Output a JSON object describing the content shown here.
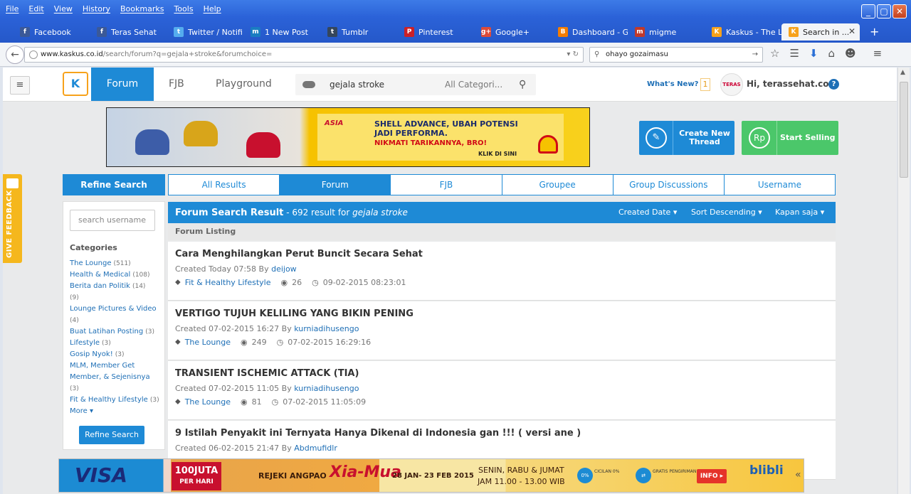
{
  "browser": {
    "menu": [
      "File",
      "Edit",
      "View",
      "History",
      "Bookmarks",
      "Tools",
      "Help"
    ],
    "tabs": [
      {
        "label": "Facebook",
        "icon": "facebook-icon",
        "color": "#3b5998",
        "glyph": "f"
      },
      {
        "label": "Teras Sehat",
        "icon": "facebook-icon",
        "color": "#3b5998",
        "glyph": "f"
      },
      {
        "label": "Twitter / Notifi...",
        "icon": "twitter-icon",
        "color": "#55acee",
        "glyph": "t"
      },
      {
        "label": "1 New Post",
        "icon": "multiply-icon",
        "color": "#1a7dc1",
        "glyph": "m"
      },
      {
        "label": "Tumblr",
        "icon": "tumblr-icon",
        "color": "#35465c",
        "glyph": "t"
      },
      {
        "label": "Pinterest",
        "icon": "pinterest-icon",
        "color": "#cb2027",
        "glyph": "P"
      },
      {
        "label": "Google+",
        "icon": "googleplus-icon",
        "color": "#dd4b39",
        "glyph": "g+"
      },
      {
        "label": "Dashboard - G...",
        "icon": "blogger-icon",
        "color": "#f57d00",
        "glyph": "B"
      },
      {
        "label": "migme",
        "icon": "migme-icon",
        "color": "#c0392b",
        "glyph": "m"
      },
      {
        "label": "Kaskus - The L...",
        "icon": "kaskus-icon",
        "color": "#f7a21b",
        "glyph": "K"
      },
      {
        "label": "Search in ...",
        "icon": "kaskus-icon",
        "color": "#f7a21b",
        "glyph": "K",
        "active": true
      }
    ],
    "new_tab": "+",
    "url_host": "www.kaskus.co.id",
    "url_path": "/search/forum?q=gejala+stroke&forumchoice=",
    "search_value": "ohayo gozaimasu",
    "win_min": "_",
    "win_max": "▢",
    "win_close": "✕"
  },
  "header": {
    "logo_text": "K",
    "tab_forum": "Forum",
    "link_fjb": "FJB",
    "link_playground": "Playground",
    "search_query": "gejala stroke",
    "search_category": "All Categori...",
    "whats_new": "What's New?",
    "notif_count": "1",
    "avatar_text": "TERAS",
    "greeting": "Hi, terassehat.com",
    "help": "?"
  },
  "banner": {
    "asia": "ASIA",
    "line1": "SHELL ADVANCE, UBAH POTENSI",
    "line1b": "JADI PERFORMA.",
    "line2": "NIKMATI TARIKANNYA, BRO!",
    "klik": "KLIK DI SINI"
  },
  "actions": {
    "create_label": "Create New Thread",
    "sell_label": "Start Selling",
    "sell_glyph": "Rp"
  },
  "feedback": {
    "label": "GIVE FEEDBACK"
  },
  "refine": {
    "title": "Refine Search",
    "username_placeholder": "search username",
    "categories_title": "Categories",
    "categories": [
      {
        "name": "The Lounge",
        "count": "(511)"
      },
      {
        "name": "Health & Medical",
        "count": "(108)"
      },
      {
        "name": "Berita dan Politik",
        "count": "(14)"
      },
      {
        "name": "(9)",
        "count": ""
      },
      {
        "name": "Lounge Pictures & Video",
        "count": ""
      },
      {
        "name": "(4)",
        "count": ""
      },
      {
        "name": "Buat Latihan Posting",
        "count": "(3)"
      },
      {
        "name": "Lifestyle",
        "count": "(3)"
      },
      {
        "name": "Gosip Nyok!",
        "count": "(3)"
      },
      {
        "name": "MLM, Member Get",
        "count": ""
      },
      {
        "name": "Member, & Sejenisnya",
        "count": ""
      },
      {
        "name": "(3)",
        "count": ""
      },
      {
        "name": "Fit & Healthy Lifestyle",
        "count": "(3)"
      }
    ],
    "more": "More ▾",
    "button": "Refine Search"
  },
  "results": {
    "tabs": [
      "All Results",
      "Forum",
      "FJB",
      "Groupee",
      "Group Discussions",
      "Username"
    ],
    "active_tab": 1,
    "head_title": "Forum Search Result",
    "head_count": " - 692 result for ",
    "head_query": "gejala stroke",
    "opt_created": "Created Date",
    "opt_sort": "Sort Descending",
    "opt_time": "Kapan saja",
    "listing_label": "Forum Listing",
    "items": [
      {
        "title": "Cara Menghilangkan Perut Buncit Secara Sehat",
        "created": "Created Today 07:58 By ",
        "author": "deijow",
        "category": "Fit & Healthy Lifestyle",
        "views": "26",
        "date": "09-02-2015 08:23:01"
      },
      {
        "title": "VERTIGO TUJUH KELILING YANG BIKIN PENING",
        "created": "Created 07-02-2015 16:27 By ",
        "author": "kurniadihusengo",
        "category": "The Lounge",
        "views": "249",
        "date": "07-02-2015 16:29:16"
      },
      {
        "title": "TRANSIENT ISCHEMIC ATTACK (TIA)",
        "created": "Created 07-02-2015 11:05 By ",
        "author": "kurniadihusengo",
        "category": "The Lounge",
        "views": "81",
        "date": "07-02-2015 11:05:09"
      },
      {
        "title": "9 Istilah Penyakit ini Ternyata Hanya Dikenal di Indonesia gan !!! ( versi ane )",
        "created": "Created 06-02-2015 21:47 By ",
        "author": "Abdmufidlr",
        "category": "",
        "views": "",
        "date": ""
      }
    ]
  },
  "bottom_ad": {
    "visa": "VISA",
    "juta": "100JUTA",
    "juta_sub": "PER HARI",
    "rejeki": "REJEKI ANGPAO",
    "xmas": "Xia-Mua",
    "dates": "28 JAN- 23 FEB 2015",
    "senin": "SENIN, RABU & JUMAT",
    "jam": "JAM 11.00 - 13.00 WIB",
    "cicilan": "CICILAN 0%",
    "gratis": "GRATIS PENGIRIMAN",
    "info": "INFO ▸",
    "blibli": "blibli",
    "chev": "«"
  }
}
